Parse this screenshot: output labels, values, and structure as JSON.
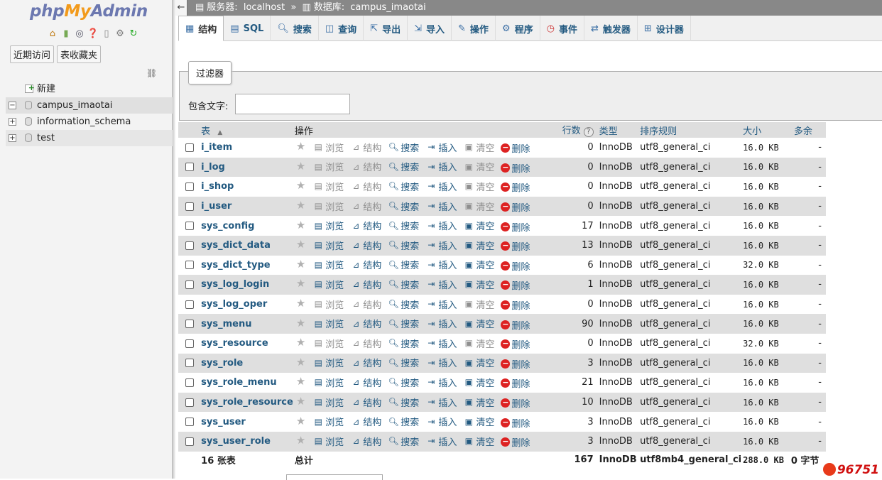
{
  "logo": {
    "php": "php",
    "my": "My",
    "admin": "Admin"
  },
  "nav": {
    "tabs": [
      "近期访问",
      "表收藏夹"
    ],
    "tree": [
      {
        "label": "新建",
        "type": "new"
      },
      {
        "label": "campus_imaotai",
        "type": "db",
        "selected": true
      },
      {
        "label": "information_schema",
        "type": "db"
      },
      {
        "label": "test",
        "type": "db"
      }
    ]
  },
  "breadcrumb": {
    "server_label": "服务器:",
    "server": "localhost",
    "sep": "»",
    "db_label": "数据库:",
    "db": "campus_imaotai"
  },
  "tabs": [
    {
      "label": "结构",
      "icon": "structure-icon",
      "active": true
    },
    {
      "label": "SQL",
      "icon": "sql-icon"
    },
    {
      "label": "搜索",
      "icon": "search-icon"
    },
    {
      "label": "查询",
      "icon": "query-icon"
    },
    {
      "label": "导出",
      "icon": "export-icon"
    },
    {
      "label": "导入",
      "icon": "import-icon"
    },
    {
      "label": "操作",
      "icon": "wrench-icon"
    },
    {
      "label": "程序",
      "icon": "routines-icon"
    },
    {
      "label": "事件",
      "icon": "events-icon"
    },
    {
      "label": "触发器",
      "icon": "triggers-icon"
    },
    {
      "label": "设计器",
      "icon": "designer-icon"
    }
  ],
  "filter": {
    "legend": "过滤器",
    "label": "包含文字:",
    "value": ""
  },
  "table": {
    "headers": {
      "table": "表",
      "sort": "▲",
      "action": "操作",
      "rows": "行数",
      "help": "?",
      "type": "类型",
      "collation": "排序规则",
      "size": "大小",
      "overhead": "多余"
    },
    "actions": [
      "浏览",
      "结构",
      "搜索",
      "插入",
      "清空",
      "删除"
    ],
    "rows": [
      {
        "name": "i_item",
        "rows": "0",
        "engine": "InnoDB",
        "collation": "utf8_general_ci",
        "size": "16.0 KB",
        "overhead": "-",
        "empty": true
      },
      {
        "name": "i_log",
        "rows": "0",
        "engine": "InnoDB",
        "collation": "utf8_general_ci",
        "size": "16.0 KB",
        "overhead": "-",
        "empty": true
      },
      {
        "name": "i_shop",
        "rows": "0",
        "engine": "InnoDB",
        "collation": "utf8_general_ci",
        "size": "16.0 KB",
        "overhead": "-",
        "empty": true
      },
      {
        "name": "i_user",
        "rows": "0",
        "engine": "InnoDB",
        "collation": "utf8_general_ci",
        "size": "16.0 KB",
        "overhead": "-",
        "empty": true
      },
      {
        "name": "sys_config",
        "rows": "17",
        "engine": "InnoDB",
        "collation": "utf8_general_ci",
        "size": "16.0 KB",
        "overhead": "-",
        "empty": false
      },
      {
        "name": "sys_dict_data",
        "rows": "13",
        "engine": "InnoDB",
        "collation": "utf8_general_ci",
        "size": "16.0 KB",
        "overhead": "-",
        "empty": false
      },
      {
        "name": "sys_dict_type",
        "rows": "6",
        "engine": "InnoDB",
        "collation": "utf8_general_ci",
        "size": "32.0 KB",
        "overhead": "-",
        "empty": false
      },
      {
        "name": "sys_log_login",
        "rows": "1",
        "engine": "InnoDB",
        "collation": "utf8_general_ci",
        "size": "16.0 KB",
        "overhead": "-",
        "empty": false
      },
      {
        "name": "sys_log_oper",
        "rows": "0",
        "engine": "InnoDB",
        "collation": "utf8_general_ci",
        "size": "16.0 KB",
        "overhead": "-",
        "empty": true
      },
      {
        "name": "sys_menu",
        "rows": "90",
        "engine": "InnoDB",
        "collation": "utf8_general_ci",
        "size": "16.0 KB",
        "overhead": "-",
        "empty": false
      },
      {
        "name": "sys_resource",
        "rows": "0",
        "engine": "InnoDB",
        "collation": "utf8_general_ci",
        "size": "32.0 KB",
        "overhead": "-",
        "empty": true
      },
      {
        "name": "sys_role",
        "rows": "3",
        "engine": "InnoDB",
        "collation": "utf8_general_ci",
        "size": "16.0 KB",
        "overhead": "-",
        "empty": false
      },
      {
        "name": "sys_role_menu",
        "rows": "21",
        "engine": "InnoDB",
        "collation": "utf8_general_ci",
        "size": "16.0 KB",
        "overhead": "-",
        "empty": false
      },
      {
        "name": "sys_role_resource",
        "rows": "10",
        "engine": "InnoDB",
        "collation": "utf8_general_ci",
        "size": "16.0 KB",
        "overhead": "-",
        "empty": false
      },
      {
        "name": "sys_user",
        "rows": "3",
        "engine": "InnoDB",
        "collation": "utf8_general_ci",
        "size": "16.0 KB",
        "overhead": "-",
        "empty": false
      },
      {
        "name": "sys_user_role",
        "rows": "3",
        "engine": "InnoDB",
        "collation": "utf8_general_ci",
        "size": "16.0 KB",
        "overhead": "-",
        "empty": false
      }
    ],
    "footer": {
      "count": "16 张表",
      "label": "总计",
      "rows": "167",
      "engine": "InnoDB",
      "collation": "utf8mb4_general_ci",
      "size": "288.0 KB",
      "overhead": "0 字节"
    }
  },
  "watermark": "96751",
  "colors": {
    "link": "#235a81",
    "topbar": "#888888",
    "delete": "#dd2222"
  }
}
